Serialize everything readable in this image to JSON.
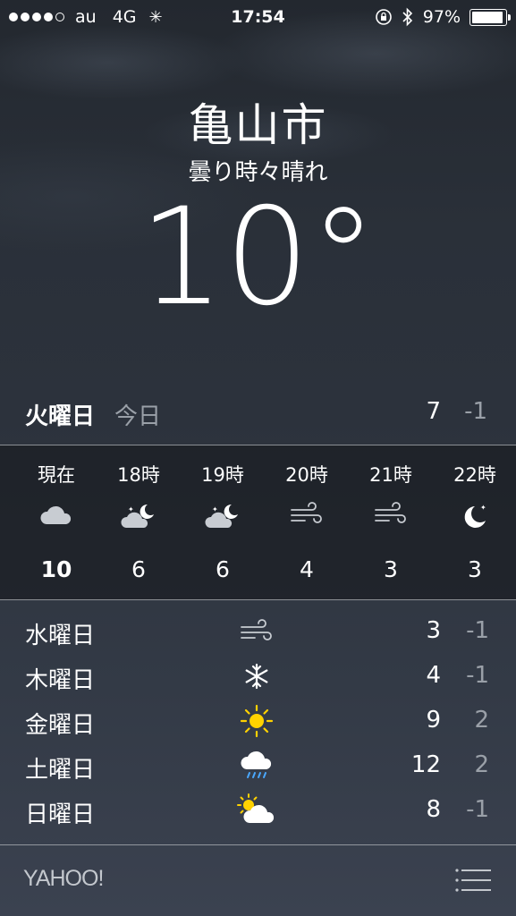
{
  "status_bar": {
    "carrier": "au",
    "network": "4G",
    "time": "17:54",
    "battery": "97%",
    "signal_strength": 4
  },
  "header": {
    "city": "亀山市",
    "condition": "曇り時々晴れ",
    "temperature": "10°"
  },
  "today": {
    "day": "火曜日",
    "label": "今日",
    "high": "7",
    "low": "-1"
  },
  "hourly": [
    {
      "time": "現在",
      "icon": "cloud-icon",
      "temp": "10"
    },
    {
      "time": "18時",
      "icon": "moon-cloud-icon",
      "temp": "6"
    },
    {
      "time": "19時",
      "icon": "moon-cloud-icon",
      "temp": "6"
    },
    {
      "time": "20時",
      "icon": "wind-icon",
      "temp": "4"
    },
    {
      "time": "21時",
      "icon": "wind-icon",
      "temp": "3"
    },
    {
      "time": "22時",
      "icon": "moon-icon",
      "temp": "3"
    }
  ],
  "daily": [
    {
      "day": "水曜日",
      "icon": "wind-icon",
      "high": "3",
      "low": "-1"
    },
    {
      "day": "木曜日",
      "icon": "snowflake-icon",
      "high": "4",
      "low": "-1"
    },
    {
      "day": "金曜日",
      "icon": "sun-icon",
      "high": "9",
      "low": "2"
    },
    {
      "day": "土曜日",
      "icon": "rain-cloud-icon",
      "high": "12",
      "low": "2"
    },
    {
      "day": "日曜日",
      "icon": "sun-cloud-icon",
      "high": "8",
      "low": "-1"
    }
  ],
  "footer": {
    "brand": "YAHOO!"
  },
  "colors": {
    "sun": "#ffd200",
    "rain": "#4aa8ff",
    "secondary_text": "#9aa0a8"
  }
}
